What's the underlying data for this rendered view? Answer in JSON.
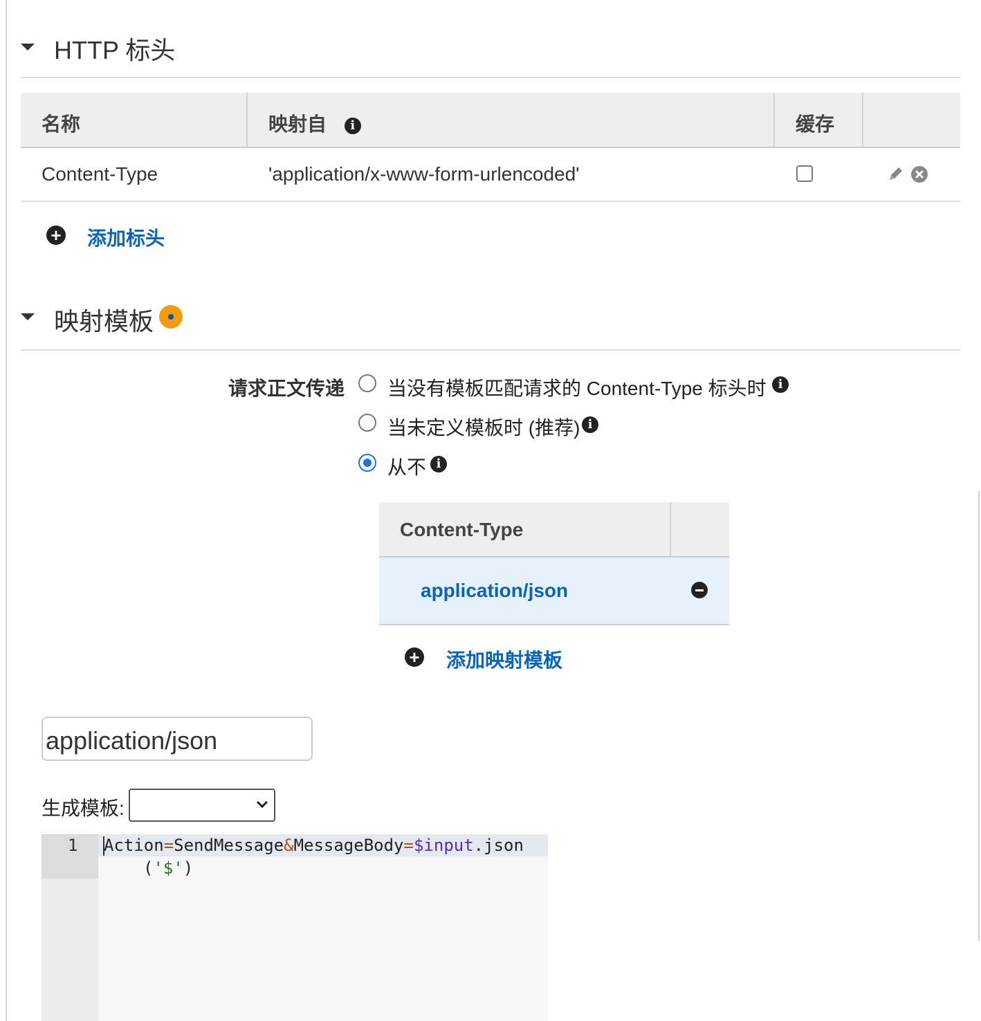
{
  "http_headers": {
    "title": "HTTP 标头",
    "columns": [
      "名称",
      "映射自",
      "缓存"
    ],
    "rows": [
      {
        "name": "Content-Type",
        "mapped_from": "'application/x-www-form-urlencoded'",
        "caching": false
      }
    ],
    "add_label": "添加标头"
  },
  "mapping_templates": {
    "title": "映射模板",
    "passthrough_label": "请求正文传递",
    "options": [
      "当没有模板匹配请求的 Content-Type 标头时",
      "当未定义模板时 (推荐)",
      "从不"
    ],
    "selected_index": 2,
    "table_header": "Content-Type",
    "types": [
      "application/json"
    ],
    "add_label": "添加映射模板",
    "content_type_input": "application/json",
    "generate_label": "生成模板:",
    "generate_selected": "",
    "editor": {
      "line_number": "1",
      "tokens": {
        "action": "Action",
        "eq1": "=",
        "send": "SendMessage",
        "amp": "&",
        "body": "MessageBody",
        "eq2": "=",
        "var": "$input",
        "json": ".json",
        "open": "(",
        "str": "'$'",
        "close": ")"
      }
    }
  },
  "colors": {
    "link": "#0b63b6",
    "accent_orange": "#f39c12",
    "radio_selected": "#1a73e8",
    "selected_row_bg": "#e6f1fb"
  }
}
